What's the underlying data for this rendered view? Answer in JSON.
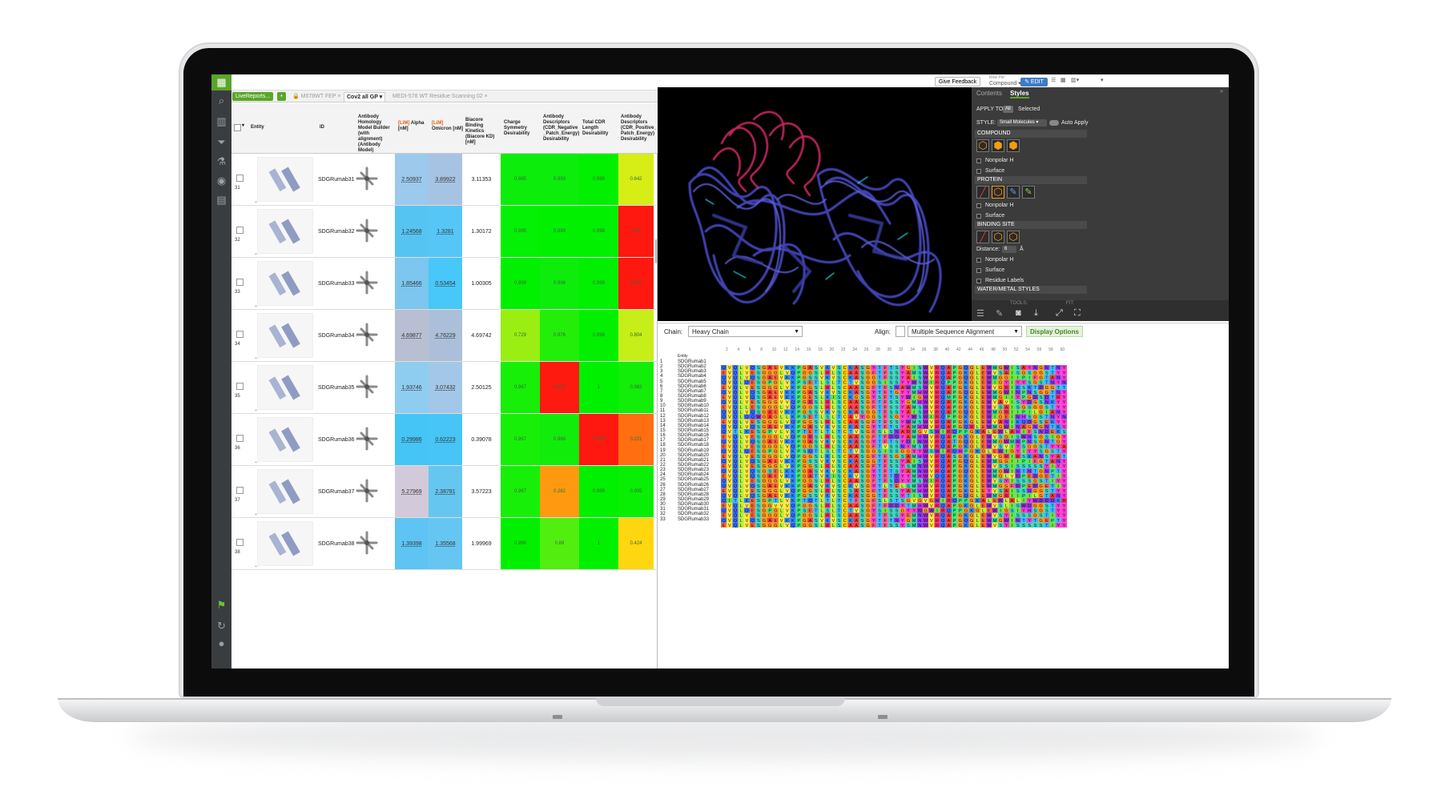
{
  "topbar": {
    "feedback_label": "Give Feedback",
    "mode_label": "Row Per",
    "mode_value": "Compound",
    "edit_label": "EDIT"
  },
  "leftbar": {
    "logo": "▦"
  },
  "tabs": {
    "livereports_label": "LiveReports...",
    "plus_label": "+",
    "items": [
      {
        "label": "M578WT FEP",
        "active": false
      },
      {
        "label": "Cov2 all GP",
        "active": true
      },
      {
        "label": "MEDI-578 WT Residue Scanning 02",
        "active": false
      }
    ]
  },
  "table": {
    "headers": [
      {
        "key": "entity",
        "text": "Entity"
      },
      {
        "key": "id",
        "text": "ID"
      },
      {
        "key": "homology",
        "text": "Antibody Homology Model Builder (with alignment) (Antibody Model)"
      },
      {
        "key": "alpha",
        "lim": "[LiM]",
        "text": "Alpha [nM]"
      },
      {
        "key": "omicron",
        "lim": "[LiM]",
        "text": "Omicron [nM]"
      },
      {
        "key": "biacore",
        "text": "Biacore Binding Kinetics (Biacore KD) [nM]"
      },
      {
        "key": "charge",
        "text": "Charge Symmetry Desirability"
      },
      {
        "key": "neg",
        "text": "Antibody Descriptors (CDR_Negative _Patch_Energy) Desirability"
      },
      {
        "key": "cdrlen",
        "text": "Total CDR Length Desirability"
      },
      {
        "key": "pos",
        "text": "Antibody Descriptors (CDR_Positive_ Patch_Energy) Desirability"
      }
    ],
    "rows": [
      {
        "num": "31",
        "id": "SDGRumab31",
        "alpha": "2.50937",
        "omicron": "3.89922",
        "biacore": "3.11353",
        "charge": "0.985",
        "neg": "0.993",
        "cdrlen": "0.999",
        "pos": "0.642"
      },
      {
        "num": "32",
        "id": "SDGRumab32",
        "alpha": "1.24568",
        "omicron": "1.3281",
        "biacore": "1.30172",
        "charge": "0.995",
        "neg": "0.999",
        "cdrlen": "0.998",
        "pos": "0.01"
      },
      {
        "num": "33",
        "id": "SDGRumab33",
        "alpha": "1.85466",
        "omicron": "0.53454",
        "biacore": "1.00305",
        "charge": "0.999",
        "neg": "0.996",
        "cdrlen": "0.999",
        "pos": "0.007"
      },
      {
        "num": "34",
        "id": "SDGRumab34",
        "alpha": "4.69877",
        "omicron": "4.76229",
        "biacore": "4.69742",
        "charge": "0.729",
        "neg": "0.976",
        "cdrlen": "0.998",
        "pos": "0.804"
      },
      {
        "num": "35",
        "id": "SDGRumab35",
        "alpha": "1.93746",
        "omicron": "3.07432",
        "biacore": "2.50125",
        "charge": "0.967",
        "neg": "0.001",
        "cdrlen": "1",
        "pos": "0.983"
      },
      {
        "num": "36",
        "id": "SDGRumab36",
        "alpha": "0.29986",
        "omicron": "0.62223",
        "biacore": "0.39078",
        "charge": "0.967",
        "neg": "0.988",
        "cdrlen": "0.003",
        "pos": "0.221"
      },
      {
        "num": "37",
        "id": "SDGRumab37",
        "alpha": "5.27969",
        "omicron": "2.38781",
        "biacore": "3.57223",
        "charge": "0.967",
        "neg": "0.282",
        "cdrlen": "0.999",
        "pos": "0.995"
      },
      {
        "num": "38",
        "id": "SDGRumab38",
        "alpha": "1.39398",
        "omicron": "1.35568",
        "biacore": "1.99969",
        "charge": "0.999",
        "neg": "0.89",
        "cdrlen": "1",
        "pos": "0.424"
      }
    ],
    "cell_colors": {
      "alpha": [
        "#9cc9ec",
        "#56c4f2",
        "#7cc6ef",
        "#b9bfd2",
        "#8fcdf0",
        "#45c4f6",
        "#d2c9da",
        "#5ec4f3"
      ],
      "omicron": [
        "#a7c3e4",
        "#55c6f6",
        "#48c8f8",
        "#abc0d8",
        "#a3c7e8",
        "#46c5f6",
        "#65c6f0",
        "#66c6f2"
      ],
      "charge": [
        "#0ced0c",
        "#04f004",
        "#00f000",
        "#9aee12",
        "#18ef08",
        "#18ef08",
        "#18ef08",
        "#00f000"
      ],
      "neg": [
        "#0ced0c",
        "#00f000",
        "#0ced0c",
        "#22ee0a",
        "#ff1a10",
        "#12ec0a",
        "#ff9a10",
        "#52ee10"
      ],
      "cdrlen": [
        "#00f000",
        "#00f000",
        "#00f000",
        "#00f000",
        "#00f000",
        "#ff1810",
        "#00f000",
        "#00f000"
      ],
      "pos": [
        "#d6ee16",
        "#ff1810",
        "#ff1810",
        "#c6ee18",
        "#12ee08",
        "#ff6e10",
        "#08ef04",
        "#ffd710"
      ]
    }
  },
  "panel": {
    "tab_contents": "Contents",
    "tab_styles": "Styles",
    "apply_to": "APPLY TO:",
    "apply_all": "All",
    "apply_selected": "Selected",
    "style_label": "STYLE:",
    "style_value": "Small Molecules",
    "auto_apply": "Auto Apply",
    "compound": "COMPOUND",
    "nonpolar_h": "Nonpolar H",
    "surface": "Surface",
    "protein": "PROTEIN",
    "binding_site": "BINDING SITE",
    "distance_label": "Distance:",
    "distance_value": "6",
    "distance_unit": "Å",
    "residue_labels": "Residue Labels",
    "water_metal": "WATER/METAL STYLES",
    "tools": "TOOLS:",
    "fit": "FIT:"
  },
  "sequence": {
    "chain_label": "Chain:",
    "chain_value": "Heavy Chain",
    "align_label": "Align:",
    "align_value": "Multiple Sequence Alignment",
    "display_options": "Display Options",
    "entity_header": "Entity",
    "ruler_ticks": [
      "2",
      "4",
      "6",
      "8",
      "10",
      "12",
      "14",
      "16",
      "18",
      "20",
      "22",
      "24",
      "26",
      "28",
      "30",
      "32",
      "34",
      "36",
      "38",
      "40",
      "42",
      "44",
      "46",
      "48",
      "50",
      "52",
      "54",
      "56",
      "58",
      "60"
    ],
    "names": [
      "SDGRumab1",
      "SDGRumab2",
      "SDGRumab3",
      "SDGRumab4",
      "SDGRumab5",
      "SDGRumab6",
      "SDGRumab7",
      "SDGRumab8",
      "SDGRumab9",
      "SDGRumab10",
      "SDGRumab11",
      "SDGRumab12",
      "SDGRumab13",
      "SDGRumab14",
      "SDGRumab15",
      "SDGRumab16",
      "SDGRumab17",
      "SDGRumab18",
      "SDGRumab19",
      "SDGRumab20",
      "SDGRumab21",
      "SDGRumab22",
      "SDGRumab23",
      "SDGRumab24",
      "SDGRumab25",
      "SDGRumab26",
      "SDGRumab27",
      "SDGRumab28",
      "SDGRumab29",
      "SDGRumab30",
      "SDGRumab31",
      "SDGRumab32",
      "SDGRumab33"
    ],
    "residue_colors": {
      "A": "#ff3a3a",
      "G": "#ff9a1a",
      "V": "#ffe93a",
      "L": "#b8f03a",
      "I": "#6ae53a",
      "S": "#3ad6c0",
      "T": "#3ab8ff",
      "Q": "#3a6cff",
      "N": "#8a3aff",
      "Y": "#ff3ad0",
      "W": "#a02ad0",
      "F": "#ff5a8a",
      "P": "#3ae87a",
      "C": "#ffd000",
      "E": "#ff6a3a",
      "K": "#2a8cff",
      "R": "#ff2a6a",
      "D": "#7a3ad8",
      "M": "#2ad89a",
      "H": "#d02aff"
    },
    "sequences": [
      "QVQLVQSGAEVKKPGASVKVSCKASGYTFTSYGISWVRQAPGQGLEWMGWISAYNGNTNY",
      "EVQLVESGGGLVQPGGSLRLSCAASGFTFSSYAMSWVRQAPGKGLEWVSAISGSGGSTYY",
      "QVQLVQSGAEVKKPGSSVKVSCKASGGTFSSYAISWVRQAPGQGLEWMGGIIPIFGTANY",
      "QVQLQESGPGLVKPSETLSLTCTVSGGSISSYYWSWIRQPPGKGLEWIGYIYYSGSTNYN",
      "EVQLVESGGGLVKPGGSLRLSCAASGFTFSNAWMSWVRQAPGKGLEWVGRIKSKTDGGTT",
      "QVQLVQSGAEVKKPGASVKVSCKASGYTFTGYYMHWVRQAPGQGLEWMGWINPNSGGTNY",
      "EVQLVQSGAEVKKPGESLKISCKGSGYSFTSYWIGWVRQMPGKGLEWMGIIYPGDSDTRY",
      "QVQLVESGGGVVQPGRSLRLSCAASGFTFSSYGMHWVRQAPGKGLEWVAVISYDGSNKYY",
      "EVQLLESGGGLVQPGGSLRLSCAASGFTFSSYAMSWVRQAPGKGLEWVSAISGSGGSTYY",
      "QVQLVQSGAEVKKPGSSVKVSCKASGGTFSSYAISWVRQAPGQGLEWMGRIIPILGIANY",
      "QVQLQQWGAGLLKPSETLSLTCAVYGGSFSGYYWSWIRQPPGKGLEWIGEINHSGSTNYN",
      "EVQLVESGGGLVQPGGSLRLSCAASGFTFSSYWMSWVRQAPGKGLEWVANIKQDGSEKYY",
      "QVQLVQSGAEVKKPGASVKVSCKASGYTFTSYAMHWVRQAPGQRLEWMGWINAGNGNTKY",
      "QVTLKESGPVLVKPTETLTLTCTVSGFSLSNARMGVSWIRQPPGKALEWLAHIFSNDEKS",
      "EVQLVESGGGLVQPGRSLRLSCAASGFTFDDYAMHWVRQAPGKGLEWVSGISWNSGSIGY",
      "QVQLVQSGAEVKKPGASVKVSCKASGYTFTSYDINWVRQATGQGLEWMGWMNPNSGNTGY",
      "EVQLVESGGGLVQPGGSLRLSCAASGFTVSSNYMSWVRQAPGKGLEWVSVIYSGGSTYYA",
      "QVQLQESGPGLVKPSQTLSLTCTVSGGSISSGGYYWSWIRQHPGKGLEWIGYIYYSGSTY",
      "EVQLVESGGGLVQPGGSLKLSCAASGFTFSGSAMHWVRQASGKGLEWVGRIRSKANSYAT",
      "QVQLVQSGAEVKKPGSSVKVSCKASGGTFSSYAISWVRQAPGQGLEWMGGIIPIFGTANY",
      "EVQLVESGGGLVKPGGSLRLSCAASGFTFSSYSMNWVRQAPGKGLEWVSSISSSSSYIYY",
      "QVQLVQSGSELKKPGASVKVSCKASGYTFTSYAMNWVRQAPGQGLEWMGWINTNTGNPTY",
      "EVQLVQSGAEVKKPGATVKISCKVSGYTFTDYYMHWVQQAPGKGLEWMGLVDPEDGETIY",
      "QVQLVESGGGLVKPGGSLRLSCAASGFTFSDYYMSWIRQAPGKGLEWVSYISSSGSTIYY",
      "QVQLVQSGAEVKKPGASVKVSCKVSGYTLTELSMHWVRQAPGKGLEWMGGFDPEDGETIY",
      "EVQLVESGGGLVQPGGSLRLSCSASGFTFSSYAMHWVRQAPGKGLEYVSAISSNGGSTYY",
      "QVQLVQSGAEVKKPGSSVKVSCKASGGTFSSYTISWVRQAPGQGLEWMGRIIPILGTANY",
      "QITLKESGPTLVKPTQTLTLTCTFSGFSLSTSGVGVGWIRQPPGKALEWLALIYWDDDKR",
      "EVQLVESGGVVVQPGGSLRLSCAASGFTFDDYTMHWVRQAPGKGLEWVSLISWDGGSTYY",
      "QVQLQESGPGLVKPSETLSLTCTVSGYSISSGYYWGWIRQPPGKGLEWIGSIYHSGSTYY",
      "EVQLVESGGGLVQPGGSLRLSCAASGFTFSSYEMNWVRQAPGKGLEWVSYISSSGSTIYY",
      "QVQLVQSGAEVKKPGASVKVSCKASGYTFTNYGMNWVRQAPGQGLEWMGWINTYTGEPTY",
      "EVQLVESGGGLVQPGGSLRLSCAASGFTFSSYSMNWVRQAPGKGLEWVSYISSSSSTIYY"
    ]
  }
}
